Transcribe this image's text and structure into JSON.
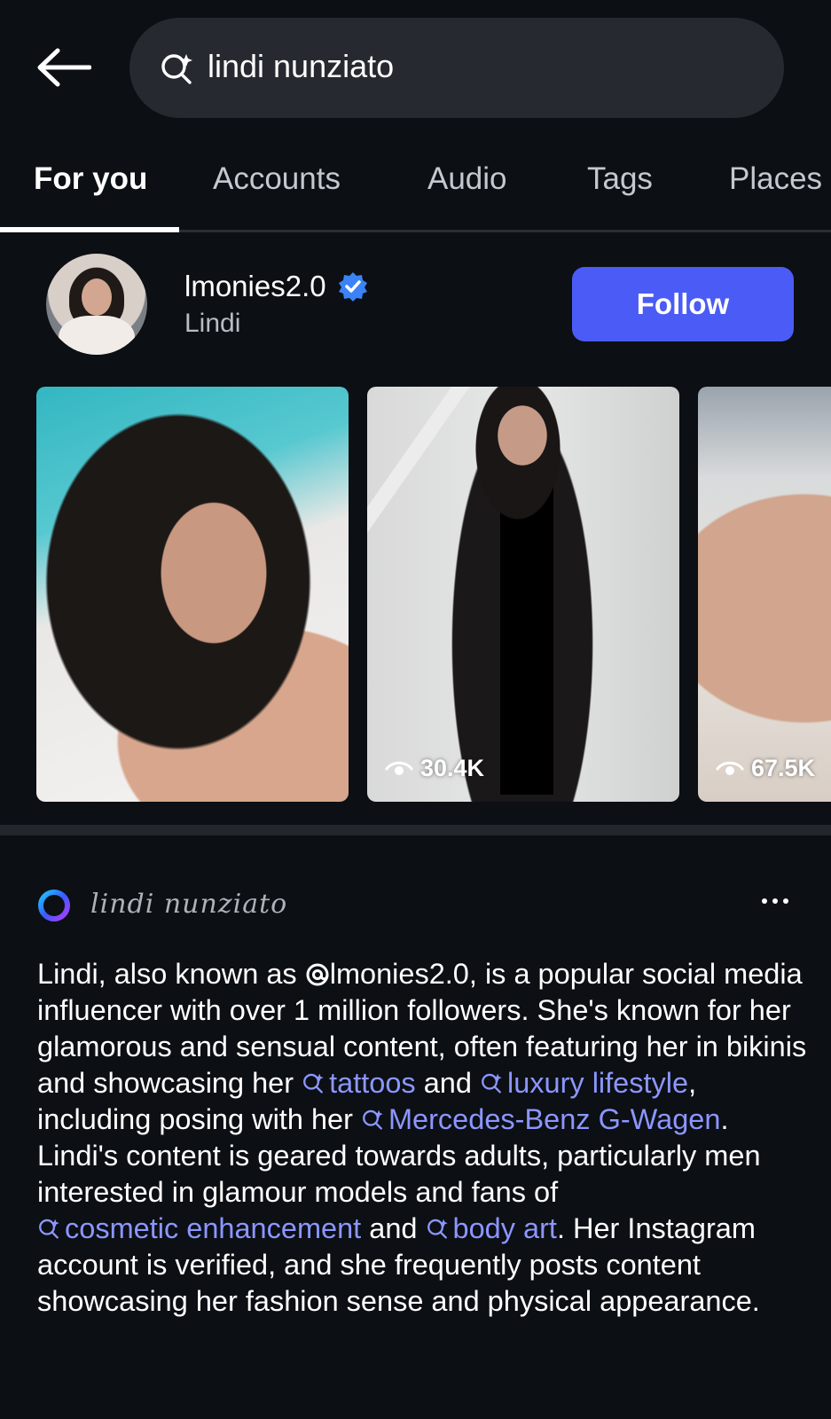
{
  "search": {
    "value": "lindi nunziato"
  },
  "tabs": [
    {
      "label": "For you",
      "active": true
    },
    {
      "label": "Accounts",
      "active": false
    },
    {
      "label": "Audio",
      "active": false
    },
    {
      "label": "Tags",
      "active": false
    },
    {
      "label": "Places",
      "active": false
    }
  ],
  "account": {
    "username": "lmonies2.0",
    "display_name": "Lindi",
    "verified": true,
    "follow_label": "Follow"
  },
  "media": [
    {
      "views": ""
    },
    {
      "views": "30.4K"
    },
    {
      "views": "67.5K"
    }
  ],
  "ai_summary": {
    "query": "lindi nunziato",
    "text": {
      "p1": "Lindi, also known as ",
      "handle": "lmonies2.0",
      "p2": ", is a popular social media influencer with over 1 million followers. She's known for her glamorous and sensual content, often featuring her in bikinis and showcasing her ",
      "link1": "tattoos",
      "p3": " and ",
      "link2": "luxury lifestyle",
      "p4": ", including posing with her ",
      "link3": "Mercedes-Benz G-Wagen",
      "p5": ". Lindi's content is geared towards adults, particularly men interested in glamour models and fans of ",
      "link4": "cosmetic enhancement",
      "p6": " and ",
      "link5": "body art",
      "p7": ". Her Instagram account is verified, and she frequently posts content showcasing her fashion sense and physical appearance."
    }
  },
  "colors": {
    "background": "#0c0f14",
    "search_bg": "#262a30",
    "follow_button": "#4a5cf5",
    "link": "#8c96ff",
    "verified_badge": "#3b82f6"
  },
  "icons": {
    "back": "arrow-left-icon",
    "search": "search-sparkle-icon",
    "verified": "verified-badge-icon",
    "views": "eye-icon",
    "ai": "meta-ai-ring-icon",
    "more": "more-dots-icon"
  }
}
